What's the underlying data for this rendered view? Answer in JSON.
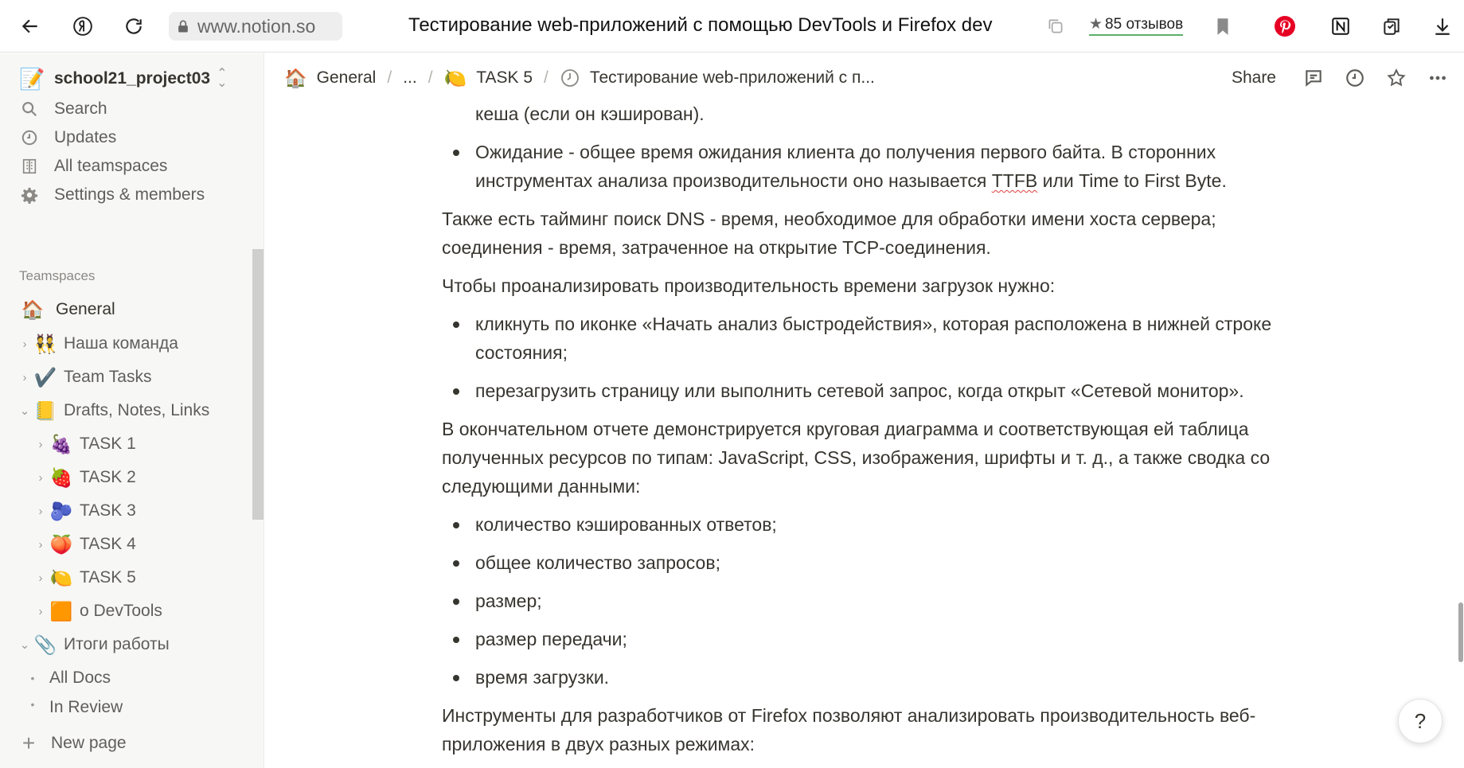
{
  "browser": {
    "url": "www.notion.so",
    "tab_title": "Тестирование web-приложений с помощью DevTools и Firefox dev",
    "reviews": "85 отзывов"
  },
  "sidebar": {
    "workspace": "school21_project03",
    "nav": [
      {
        "label": "Search",
        "icon": "search-icon"
      },
      {
        "label": "Updates",
        "icon": "clock-icon"
      },
      {
        "label": "All teamspaces",
        "icon": "building-icon"
      },
      {
        "label": "Settings & members",
        "icon": "gear-icon"
      }
    ],
    "section_title": "Teamspaces",
    "tree": [
      {
        "label": "General",
        "emoji": "🏠"
      },
      {
        "label": "Наша команда",
        "emoji": "👯"
      },
      {
        "label": "Team Tasks",
        "emoji": "✔️"
      },
      {
        "label": "Drafts, Notes, Links",
        "emoji": "📒"
      },
      {
        "label": "TASK 1",
        "emoji": "🍇"
      },
      {
        "label": "TASK 2",
        "emoji": "🍓"
      },
      {
        "label": "TASK 3",
        "emoji": "🫐"
      },
      {
        "label": "TASK 4",
        "emoji": "🍑"
      },
      {
        "label": "TASK 5",
        "emoji": "🍋"
      },
      {
        "label": "о DevTools",
        "emoji": "🟧"
      },
      {
        "label": "Итоги работы",
        "emoji": "📎"
      },
      {
        "label": "All Docs"
      },
      {
        "label": "In Review"
      }
    ],
    "new_page": "New page"
  },
  "topbar": {
    "breadcrumb": {
      "general": "General",
      "ellipsis": "...",
      "task": "TASK 5",
      "page": "Тестирование web-приложений с п..."
    },
    "share": "Share"
  },
  "content": {
    "b1_cont": "кеша (если он кэширован).",
    "b2_a": "Ожидание - общее время ожидания клиента до получения первого байта. В сторонних инструментах анализа производительности оно называется ",
    "b2_ttfb": "TTFB",
    "b2_b": " или Time to First Byte.",
    "p1": "Также есть тайминг поиск DNS - время, необходимое для обработки имени хоста сервера; соединения - время, затраченное на открытие TCP-соединения.",
    "p2": "Чтобы проанализировать производительность времени загрузок нужно:",
    "list1": [
      "кликнуть по иконке «Начать анализ быстродействия», которая расположена в нижней строке состояния;",
      "перезагрузить страницу или выполнить сетевой запрос, когда открыт «Сетевой монитор»."
    ],
    "p3": "В окончательном отчете демонстрируется круговая диаграмма и соответствующая ей таблица полученных ресурсов по типам: JavaScript, CSS, изображения, шрифты и т. д., а также сводка со следующими данными:",
    "list2": [
      "количество кэшированных ответов;",
      "общее количество запросов;",
      "размер;",
      "размер передачи;",
      "время загрузки."
    ],
    "p4": "Инструменты для разработчиков от Firefox позволяют анализировать производительность веб-приложения в двух разных режимах:"
  },
  "help": "?",
  "colors": {
    "sidebar_bg": "#f7f7f5",
    "text": "#37352f",
    "pinterest": "#e60023"
  }
}
